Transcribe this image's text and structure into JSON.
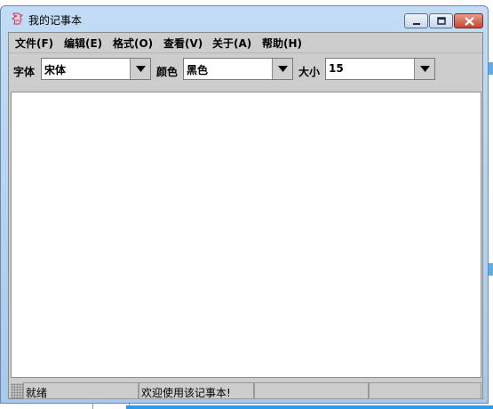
{
  "window": {
    "title": "我的记事本"
  },
  "menu": [
    {
      "label": "文件(F)"
    },
    {
      "label": "编辑(E)"
    },
    {
      "label": "格式(O)"
    },
    {
      "label": "查看(V)"
    },
    {
      "label": "关于(A)"
    },
    {
      "label": "帮助(H)"
    }
  ],
  "toolbar": {
    "font_label": "字体",
    "font_value": "宋体",
    "color_label": "颜色",
    "color_value": "黑色",
    "size_label": "大小",
    "size_value": "15"
  },
  "editor": {
    "content": ""
  },
  "status": {
    "state": "就绪",
    "message": "欢迎使用该记事本!",
    "cell3": "",
    "cell4": ""
  },
  "colors": {
    "title_gradient_top": "#c2dcf5",
    "client_bg": "#cdcdcd",
    "close_button": "#c7452f"
  }
}
